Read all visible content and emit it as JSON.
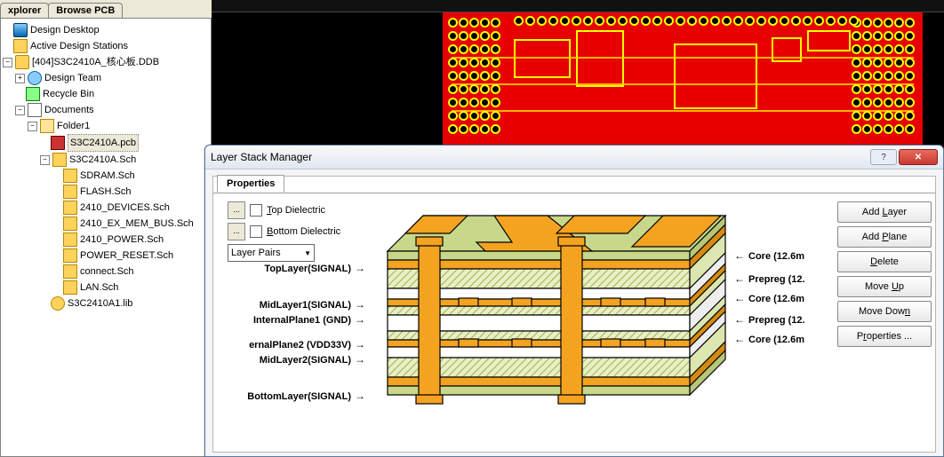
{
  "tabs": {
    "explorer": "xplorer",
    "browse": "Browse PCB"
  },
  "tree": {
    "root": "Design Desktop",
    "stations": "Active Design Stations",
    "ddb": "[404]S3C2410A_核心板.DDB",
    "team": "Design Team",
    "recycle": "Recycle Bin",
    "documents": "Documents",
    "folder": "Folder1",
    "files": {
      "pcb": "S3C2410A.pcb",
      "sch_main": "S3C2410A.Sch",
      "sdram": "SDRAM.Sch",
      "flash": "FLASH.Sch",
      "devices": "2410_DEVICES.Sch",
      "exmem": "2410_EX_MEM_BUS.Sch",
      "power": "2410_POWER.Sch",
      "preset": "POWER_RESET.Sch",
      "connect": "connect.Sch",
      "lan": "LAN.Sch",
      "lib": "S3C2410A1.lib"
    }
  },
  "dialog": {
    "title": "Layer Stack Manager",
    "tab": "Properties",
    "top_dielectric": "Top Dielectric",
    "bottom_dielectric": "Bottom Dielectric",
    "select_value": "Layer Pairs",
    "layers": {
      "top": "TopLayer(SIGNAL)",
      "mid1": "MidLayer1(SIGNAL)",
      "ip1": "InternalPlane1  (GND)",
      "ip2": "ernalPlane2  (VDD33V)",
      "mid2": "MidLayer2(SIGNAL)",
      "bot": "BottomLayer(SIGNAL)"
    },
    "materials": {
      "core1": "Core  (12.6m",
      "prepreg1": "Prepreg  (12.",
      "core2": "Core  (12.6m",
      "prepreg2": "Prepreg  (12.",
      "core3": "Core  (12.6m"
    },
    "buttons": {
      "add_layer": "Add Layer",
      "add_plane": "Add Plane",
      "delete": "Delete",
      "move_up": "Move Up",
      "move_down": "Move Down",
      "properties": "Properties ..."
    },
    "ellipsis": "..."
  }
}
